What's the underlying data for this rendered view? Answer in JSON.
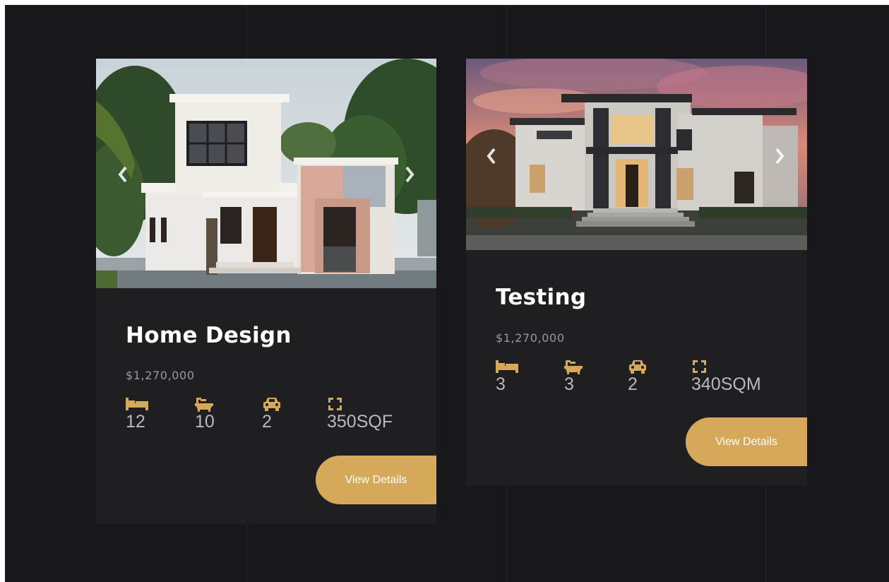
{
  "listings": [
    {
      "title": "Home Design",
      "price": "$1,270,000",
      "specs": {
        "bedrooms": "12",
        "bathrooms": "10",
        "garage": "2",
        "area": "350SQF"
      },
      "button_label": "View Details"
    },
    {
      "title": "Testing",
      "price": "$1,270,000",
      "specs": {
        "bedrooms": "3",
        "bathrooms": "3",
        "garage": "2",
        "area": "340SQM"
      },
      "button_label": "View Details"
    }
  ],
  "icons": {
    "bed": "bed-icon",
    "bath": "bathtub-icon",
    "garage": "car-icon",
    "area": "area-expand-icon",
    "prev": "chevron-left-icon",
    "next": "chevron-right-icon"
  },
  "colors": {
    "background": "#17171c",
    "card": "#1f1f22",
    "accent": "#d6a95a",
    "title": "#ffffff",
    "price": "#9a9a9e",
    "spec_value": "#b9b9bc"
  }
}
